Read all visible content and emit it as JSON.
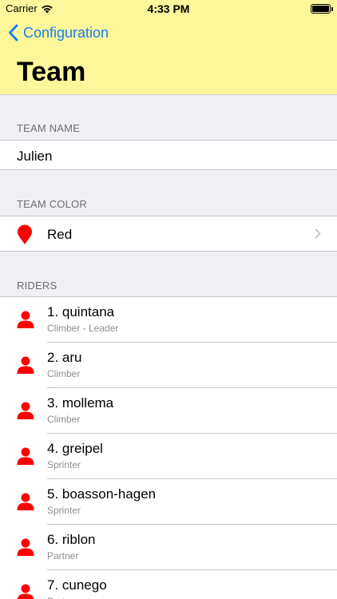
{
  "status_bar": {
    "carrier": "Carrier",
    "time": "4:33 PM"
  },
  "nav": {
    "back_label": "Configuration",
    "title": "Team"
  },
  "team_name": {
    "header": "TEAM NAME",
    "value": "Julien"
  },
  "team_color": {
    "header": "TEAM COLOR",
    "value": "Red",
    "color": "#ff0000",
    "icon": "map-pin-icon"
  },
  "riders": {
    "header": "RIDERS",
    "icon_color": "#ff0000",
    "items": [
      {
        "name": "1. quintana",
        "role": "Climber - Leader"
      },
      {
        "name": "2. aru",
        "role": "Climber"
      },
      {
        "name": "3. mollema",
        "role": "Climber"
      },
      {
        "name": "4. greipel",
        "role": "Sprinter"
      },
      {
        "name": "5. boasson-hagen",
        "role": "Sprinter"
      },
      {
        "name": "6. riblon",
        "role": "Partner"
      },
      {
        "name": "7. cunego",
        "role": "Partner"
      }
    ]
  },
  "colors": {
    "header_bg": "#fbf79a",
    "tint": "#1a7cf4",
    "page_bg": "#efeff4"
  }
}
